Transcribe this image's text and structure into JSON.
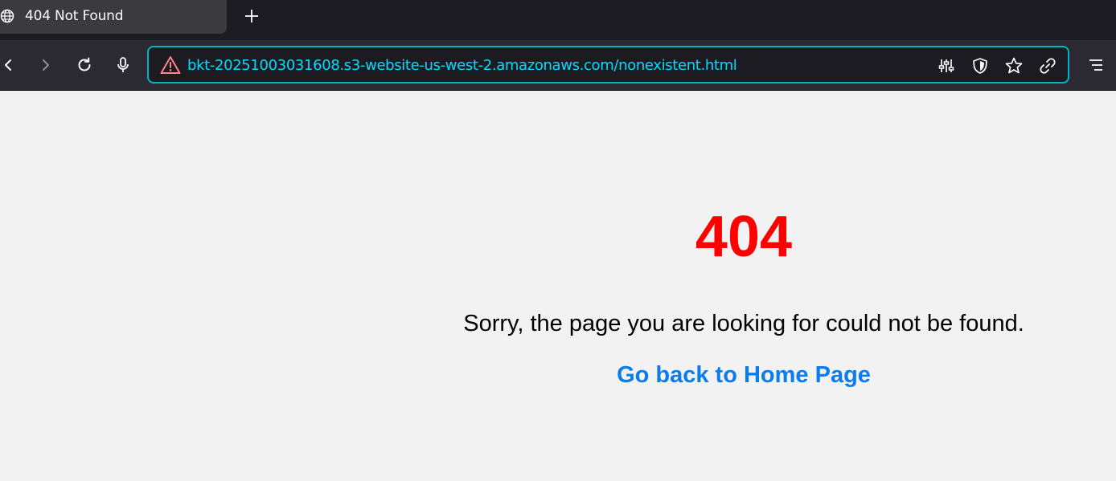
{
  "tab": {
    "title": "404 Not Found"
  },
  "toolbar": {
    "back_icon": "back-arrow-icon",
    "forward_icon": "forward-arrow-icon",
    "reload_icon": "reload-icon",
    "mic_icon": "microphone-icon",
    "menu_icon": "hamburger-menu-icon"
  },
  "urlbar": {
    "url": "bkt-20251003031608.s3-website-us-west-2.amazonaws.com/nonexistent.html",
    "warning_icon": "insecure-warning-icon",
    "accent_color": "#00ddff"
  },
  "page": {
    "error_code": "404",
    "message": "Sorry, the page you are looking for could not be found.",
    "home_link": "Go back to Home Page",
    "error_color": "#ff0000",
    "link_color": "#0a7cf0"
  }
}
